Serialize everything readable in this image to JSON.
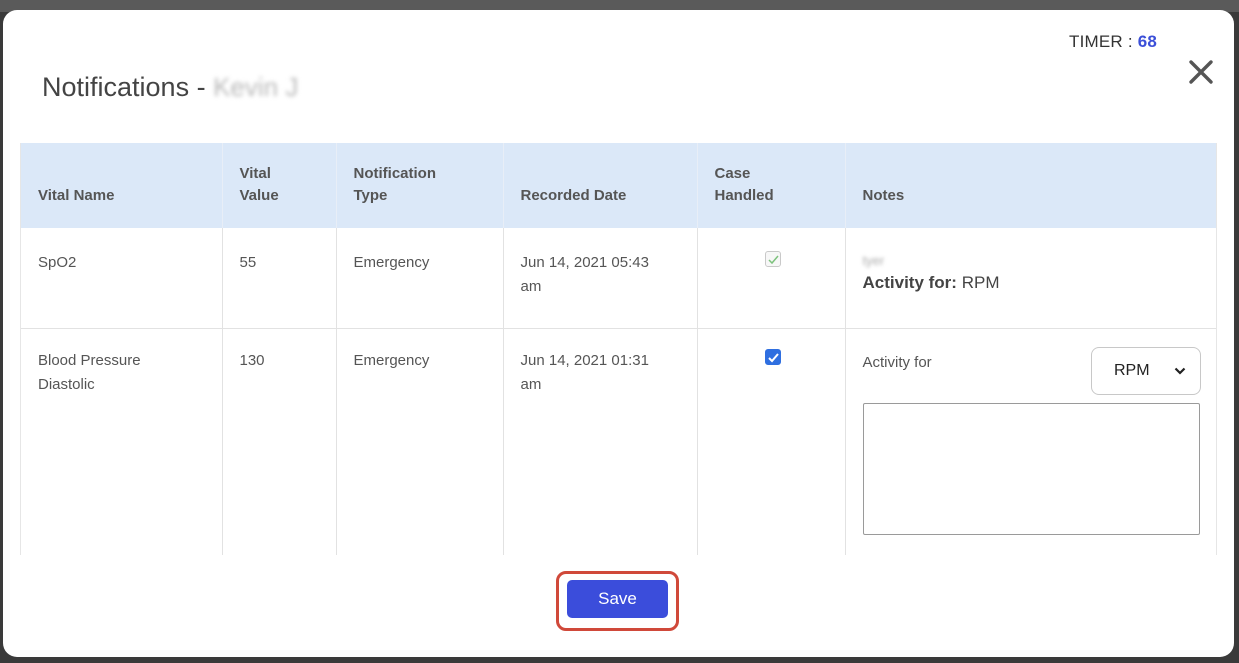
{
  "modal": {
    "title": "Notifications -",
    "patient_name": "Kevin J",
    "timer_label": "TIMER :",
    "timer_value": "68",
    "close_icon": "close-icon",
    "save_label": "Save"
  },
  "table": {
    "headers": [
      "Vital Name",
      "Vital Value",
      "Notification Type",
      "Recorded Date",
      "Case Handled",
      "Notes"
    ],
    "rows": [
      {
        "vital_name": "SpO2",
        "vital_value": "55",
        "notification_type": "Emergency",
        "recorded_date": "Jun 14, 2021 05:43 am",
        "case_handled": true,
        "case_handled_disabled": true,
        "note_text": "tyer",
        "activity_label": "Activity for:",
        "activity_value": "RPM"
      },
      {
        "vital_name": "Blood Pressure Diastolic",
        "vital_value": "130",
        "notification_type": "Emergency",
        "recorded_date": "Jun 14, 2021 01:31 am",
        "case_handled": true,
        "case_handled_disabled": false,
        "activity_label": "Activity for",
        "activity_select_value": "RPM",
        "notes_input_value": ""
      }
    ]
  },
  "colors": {
    "accent": "#3b4ddb",
    "header_bg": "#dbe8f8",
    "timer_value": "#3b4fd8",
    "highlight": "#d0493a"
  }
}
